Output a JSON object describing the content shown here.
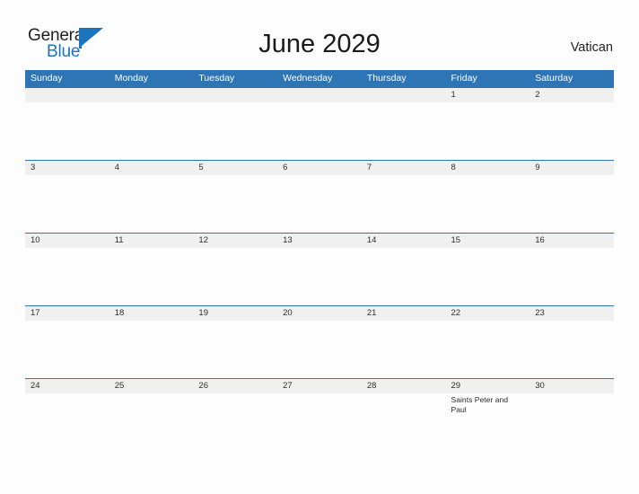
{
  "brand": {
    "name_part1": "General",
    "name_part2": "Blue",
    "accent_color": "#1c74bc"
  },
  "header": {
    "title": "June 2029",
    "region": "Vatican"
  },
  "theme": {
    "header_blue": "#2e75b6",
    "band_gray": "#f0f0f0",
    "page_background": "#fdfdfe",
    "text_color": "#2d2d2d"
  },
  "calendar": {
    "weekdays": [
      "Sunday",
      "Monday",
      "Tuesday",
      "Wednesday",
      "Thursday",
      "Friday",
      "Saturday"
    ],
    "weeks": [
      {
        "days": [
          {
            "num": "",
            "event": ""
          },
          {
            "num": "",
            "event": ""
          },
          {
            "num": "",
            "event": ""
          },
          {
            "num": "",
            "event": ""
          },
          {
            "num": "",
            "event": ""
          },
          {
            "num": "1",
            "event": ""
          },
          {
            "num": "2",
            "event": ""
          }
        ]
      },
      {
        "days": [
          {
            "num": "3",
            "event": ""
          },
          {
            "num": "4",
            "event": ""
          },
          {
            "num": "5",
            "event": ""
          },
          {
            "num": "6",
            "event": ""
          },
          {
            "num": "7",
            "event": ""
          },
          {
            "num": "8",
            "event": ""
          },
          {
            "num": "9",
            "event": ""
          }
        ]
      },
      {
        "days": [
          {
            "num": "10",
            "event": ""
          },
          {
            "num": "11",
            "event": ""
          },
          {
            "num": "12",
            "event": ""
          },
          {
            "num": "13",
            "event": ""
          },
          {
            "num": "14",
            "event": ""
          },
          {
            "num": "15",
            "event": ""
          },
          {
            "num": "16",
            "event": ""
          }
        ]
      },
      {
        "days": [
          {
            "num": "17",
            "event": ""
          },
          {
            "num": "18",
            "event": ""
          },
          {
            "num": "19",
            "event": ""
          },
          {
            "num": "20",
            "event": ""
          },
          {
            "num": "21",
            "event": ""
          },
          {
            "num": "22",
            "event": ""
          },
          {
            "num": "23",
            "event": ""
          }
        ]
      },
      {
        "days": [
          {
            "num": "24",
            "event": ""
          },
          {
            "num": "25",
            "event": ""
          },
          {
            "num": "26",
            "event": ""
          },
          {
            "num": "27",
            "event": ""
          },
          {
            "num": "28",
            "event": ""
          },
          {
            "num": "29",
            "event": "Saints Peter and Paul"
          },
          {
            "num": "30",
            "event": ""
          }
        ]
      }
    ]
  }
}
